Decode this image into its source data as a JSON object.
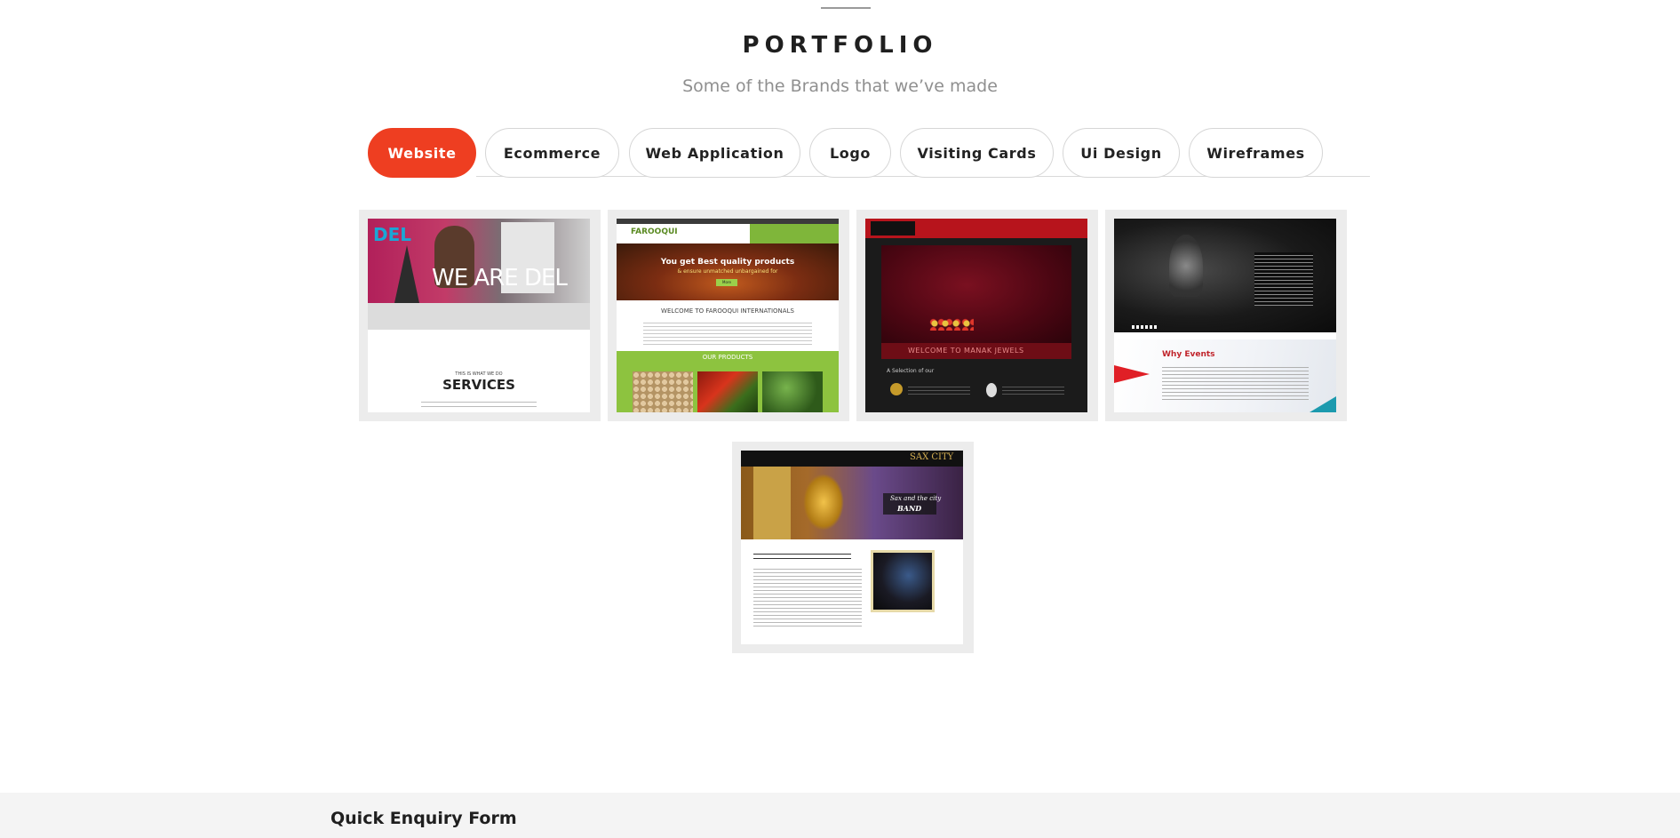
{
  "section": {
    "title": "PORTFOLIO",
    "subtitle": "Some of the Brands that we’ve made"
  },
  "tabs": [
    {
      "label": "Website",
      "active": true
    },
    {
      "label": "Ecommerce",
      "active": false
    },
    {
      "label": "Web Application",
      "active": false
    },
    {
      "label": "Logo",
      "active": false
    },
    {
      "label": "Visiting Cards",
      "active": false
    },
    {
      "label": "Ui Design",
      "active": false
    },
    {
      "label": "Wireframes",
      "active": false
    }
  ],
  "portfolio_items": [
    {
      "logo": "DEL",
      "headline": "WE ARE DEL",
      "kicker": "THIS IS WHAT WE DO",
      "section_heading": "SERVICES"
    },
    {
      "logo": "FAROOQUI",
      "headline": "You get Best quality products",
      "subheadline": "& ensure unmatched unbargained for",
      "button": "More",
      "welcome": "WELCOME TO FAROOQUI INTERNATIONALS",
      "products_heading": "OUR PRODUCTS"
    },
    {
      "welcome": "WELCOME TO MANAK JEWELS",
      "selection": "A Selection of our"
    },
    {
      "heading": "Why Events"
    },
    {
      "logo": "SAX CITY",
      "band_line1": "Sax and the city",
      "band_line2": "BAND"
    }
  ],
  "footer": {
    "form_title": "Quick Enquiry Form"
  },
  "colors": {
    "accent": "#ee3e21",
    "footer_bg": "#f4f4f4"
  }
}
